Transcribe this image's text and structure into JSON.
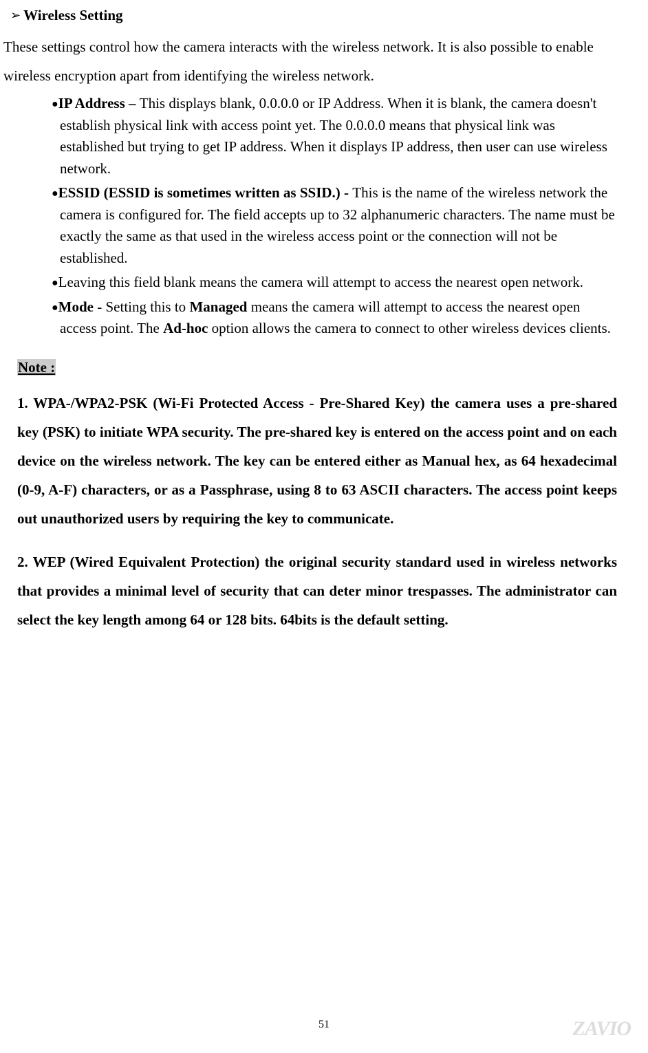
{
  "heading": "Wireless Setting",
  "intro": "These settings control how the camera interacts with the wireless network. It is also possible to enable wireless encryption apart from identifying the wireless network.",
  "bullets": {
    "b1_label": "IP Address – ",
    "b1_text": "This displays blank, 0.0.0.0 or IP Address. When it is blank, the camera doesn't establish physical link with access point yet. The 0.0.0.0 means that physical link was established but trying to get IP address. When it displays IP address, then user can use wireless network.",
    "b2_label": "ESSID (ESSID is sometimes written as SSID.) - ",
    "b2_text": "This is the name of the wireless network the camera is configured for. The field accepts up to 32 alphanumeric characters. The name must be exactly the same as that used in the wireless access point or the connection will not be established.",
    "b3_text": "Leaving this field blank means the camera will attempt to access the nearest open network.",
    "b4_label": "Mode",
    "b4_t1": " - Setting this to ",
    "b4_managed": "Managed",
    "b4_t2": " means the camera will attempt to access the nearest open access point. The ",
    "b4_adhoc": "Ad-hoc",
    "b4_t3": " option allows the camera to connect to other wireless devices clients."
  },
  "note_label": "Note :",
  "note1": "1. WPA-/WPA2-PSK (Wi-Fi Protected Access - Pre-Shared Key) the camera uses a pre-shared key (PSK) to initiate WPA security. The pre-shared key is entered on the access point and on each device on the wireless network. The key can be entered either as Manual hex, as 64 hexadecimal (0-9, A-F) characters, or as a Passphrase, using 8 to 63 ASCII characters. The access point keeps out unauthorized users by requiring the key to communicate.",
  "note2": "2. WEP (Wired Equivalent Protection) the original security standard used in wireless networks that provides a minimal level of security that can deter minor trespasses. The administrator can select the key length among 64 or 128 bits. 64bits is the default setting.",
  "page_number": "51",
  "brand": "ZAVIO"
}
